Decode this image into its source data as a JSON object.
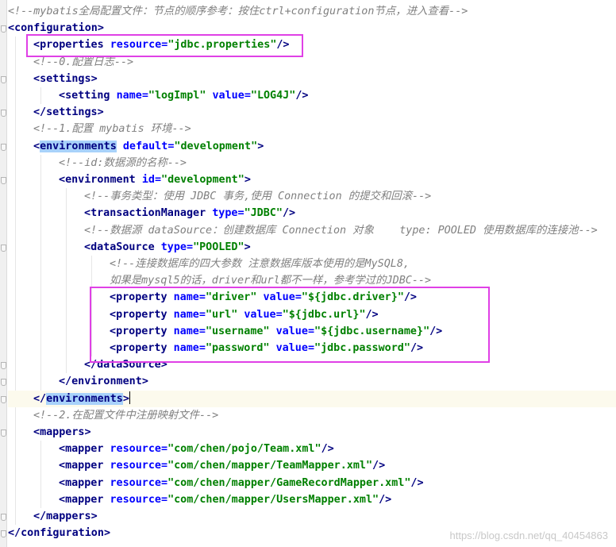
{
  "code_lines": [
    {
      "indent": 0,
      "kind": "comment",
      "text": "<!--mybatis全局配置文件：节点的顺序参考：按住ctrl+configuration节点，进入查看-->"
    },
    {
      "indent": 0,
      "kind": "open",
      "tag": "configuration",
      "attrs": []
    },
    {
      "indent": 1,
      "kind": "selfclose",
      "tag": "properties",
      "attrs": [
        {
          "name": "resource",
          "value": "jdbc.properties"
        }
      ]
    },
    {
      "indent": 1,
      "kind": "comment",
      "text": "<!--0.配置日志-->"
    },
    {
      "indent": 1,
      "kind": "open",
      "tag": "settings",
      "attrs": []
    },
    {
      "indent": 2,
      "kind": "selfclose",
      "tag": "setting",
      "attrs": [
        {
          "name": "name",
          "value": "logImpl"
        },
        {
          "name": "value",
          "value": "LOG4J"
        }
      ]
    },
    {
      "indent": 1,
      "kind": "close",
      "tag": "settings"
    },
    {
      "indent": 1,
      "kind": "comment",
      "text": "<!--1.配置 mybatis 环境-->"
    },
    {
      "indent": 1,
      "kind": "open",
      "tag": "environments",
      "attrs": [
        {
          "name": "default",
          "value": "development"
        }
      ],
      "tag_highlight": true
    },
    {
      "indent": 2,
      "kind": "comment",
      "text": "<!--id:数据源的名称-->"
    },
    {
      "indent": 2,
      "kind": "open",
      "tag": "environment",
      "attrs": [
        {
          "name": "id",
          "value": "development"
        }
      ]
    },
    {
      "indent": 3,
      "kind": "comment",
      "text": "<!--事务类型：使用 JDBC 事务,使用 Connection 的提交和回滚-->"
    },
    {
      "indent": 3,
      "kind": "selfclose",
      "tag": "transactionManager",
      "attrs": [
        {
          "name": "type",
          "value": "JDBC"
        }
      ]
    },
    {
      "indent": 3,
      "kind": "comment",
      "text": "<!--数据源 dataSource：创建数据库 Connection 对象    type: POOLED 使用数据库的连接池-->"
    },
    {
      "indent": 3,
      "kind": "open",
      "tag": "dataSource",
      "attrs": [
        {
          "name": "type",
          "value": "POOLED"
        }
      ]
    },
    {
      "indent": 4,
      "kind": "comment",
      "text": "<!--连接数据库的四大参数 注意数据库版本使用的是MySQL8,"
    },
    {
      "indent": 4,
      "kind": "comment",
      "text": "如果是mysql5的话，driver和url都不一样，参考学过的JDBC-->"
    },
    {
      "indent": 4,
      "kind": "selfclose",
      "tag": "property",
      "attrs": [
        {
          "name": "name",
          "value": "driver"
        },
        {
          "name": "value",
          "value": "${jdbc.driver}"
        }
      ]
    },
    {
      "indent": 4,
      "kind": "selfclose",
      "tag": "property",
      "attrs": [
        {
          "name": "name",
          "value": "url"
        },
        {
          "name": "value",
          "value": "${jdbc.url}"
        }
      ]
    },
    {
      "indent": 4,
      "kind": "selfclose",
      "tag": "property",
      "attrs": [
        {
          "name": "name",
          "value": "username"
        },
        {
          "name": "value",
          "value": "${jdbc.username}"
        }
      ]
    },
    {
      "indent": 4,
      "kind": "selfclose",
      "tag": "property",
      "attrs": [
        {
          "name": "name",
          "value": "password"
        },
        {
          "name": "value",
          "value": "jdbc.password"
        }
      ]
    },
    {
      "indent": 3,
      "kind": "close",
      "tag": "dataSource"
    },
    {
      "indent": 2,
      "kind": "close",
      "tag": "environment"
    },
    {
      "indent": 1,
      "kind": "close",
      "tag": "environments",
      "tag_highlight": true,
      "caret": true,
      "current_line": true
    },
    {
      "indent": 1,
      "kind": "comment",
      "text": "<!--2.在配置文件中注册映射文件-->"
    },
    {
      "indent": 1,
      "kind": "open",
      "tag": "mappers",
      "attrs": []
    },
    {
      "indent": 2,
      "kind": "selfclose",
      "tag": "mapper",
      "attrs": [
        {
          "name": "resource",
          "value": "com/chen/pojo/Team.xml"
        }
      ]
    },
    {
      "indent": 2,
      "kind": "selfclose",
      "tag": "mapper",
      "attrs": [
        {
          "name": "resource",
          "value": "com/chen/mapper/TeamMapper.xml"
        }
      ]
    },
    {
      "indent": 2,
      "kind": "selfclose",
      "tag": "mapper",
      "attrs": [
        {
          "name": "resource",
          "value": "com/chen/mapper/GameRecordMapper.xml"
        }
      ]
    },
    {
      "indent": 2,
      "kind": "selfclose",
      "tag": "mapper",
      "attrs": [
        {
          "name": "resource",
          "value": "com/chen/mapper/UsersMapper.xml"
        }
      ]
    },
    {
      "indent": 1,
      "kind": "close",
      "tag": "mappers"
    },
    {
      "indent": 0,
      "kind": "close",
      "tag": "configuration"
    }
  ],
  "watermark": "https://blog.csdn.net/qq_40454863",
  "colors": {
    "tag": "#000080",
    "attribute": "#0000ff",
    "value": "#008000",
    "comment": "#808080",
    "annotation_box": "#e040e6",
    "tag_highlight": "#a8d2fa",
    "current_line": "#fcfaed"
  }
}
